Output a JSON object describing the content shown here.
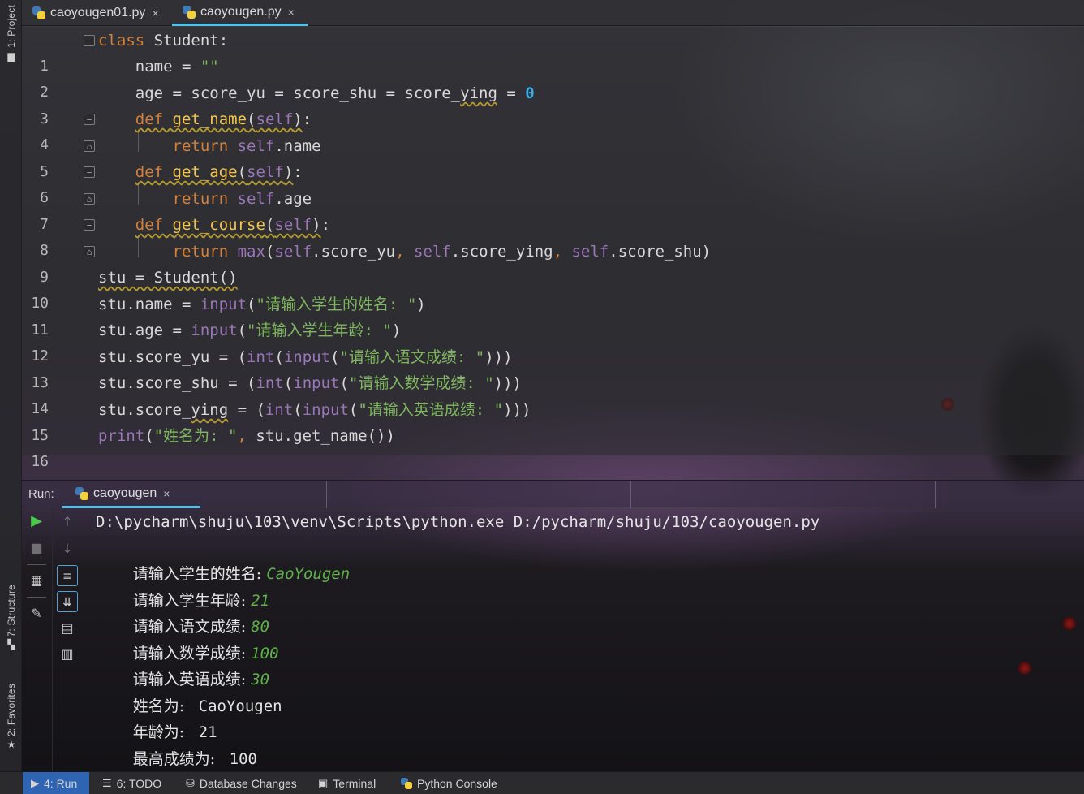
{
  "sidebar": {
    "project": "1: Project",
    "structure": "7: Structure",
    "favorites": "2: Favorites"
  },
  "tabs": [
    {
      "label": "caoyougen01.py",
      "close": "×"
    },
    {
      "label": "caoyougen.py",
      "close": "×"
    }
  ],
  "editor": {
    "line_numbers": [
      "1",
      "2",
      "3",
      "4",
      "5",
      "6",
      "7",
      "8",
      "9",
      "10",
      "11",
      "12",
      "13",
      "14",
      "15",
      "16"
    ]
  },
  "run": {
    "label": "Run:",
    "tab_label": "caoyougen",
    "tab_close": "×"
  },
  "console": {
    "command": "D:\\pycharm\\shuju\\103\\venv\\Scripts\\python.exe D:/pycharm/shuju/103/caoyougen.py",
    "entries": [
      {
        "prompt": "请输入学生的姓名: ",
        "value": "CaoYougen"
      },
      {
        "prompt": "请输入学生年龄: ",
        "value": "21"
      },
      {
        "prompt": "请输入语文成绩: ",
        "value": "80"
      },
      {
        "prompt": "请输入数学成绩: ",
        "value": "100"
      },
      {
        "prompt": "请输入英语成绩: ",
        "value": "30"
      }
    ],
    "results": [
      {
        "label": "姓名为: ",
        "value": " CaoYougen"
      },
      {
        "label": "年龄为: ",
        "value": " 21"
      },
      {
        "label": "最高成绩为: ",
        "value": " 100"
      }
    ]
  },
  "statusbar": {
    "run": "4: Run",
    "todo": "6: TODO",
    "db": "Database Changes",
    "terminal": "Terminal",
    "pyconsole": "Python Console"
  },
  "colors": {
    "keyword": "#d3813c",
    "function": "#f5c54a",
    "self": "#9b76b8",
    "number": "#3aaee9",
    "string": "#7fb85f",
    "user_input": "#5fb24a",
    "accent": "#4fc1e9"
  },
  "icons": {
    "rerun": "run-icon",
    "stop": "stop-icon",
    "layout": "layout-icon",
    "pin": "pin-icon",
    "up": "arrow-up-icon",
    "down": "arrow-down-icon",
    "wrap": "soft-wrap-icon",
    "scroll": "scroll-to-end-icon",
    "print": "print-icon",
    "trash": "trash-icon"
  }
}
